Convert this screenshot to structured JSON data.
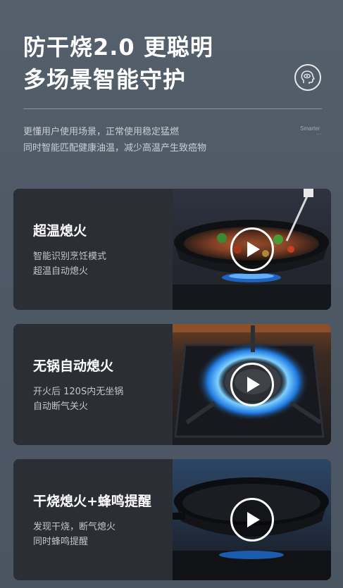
{
  "header": {
    "title_line1": "防干烧2.0 更聪明",
    "title_line2": "多场景智能守护",
    "badge_icon": "head-eye-icon"
  },
  "intro": {
    "line1": "更懂用户使用场景，正常使用稳定猛燃",
    "line2": "同时智能匹配健康油温，减少高温产生致癌物",
    "tag": "Smarter",
    "tag_dots": "···"
  },
  "cards": [
    {
      "title": "超温熄火",
      "line1": "智能识别烹饪模式",
      "line2": "超温自动熄火",
      "media": "wok-with-vegetables-and-thermometer",
      "play_icon": "play-icon"
    },
    {
      "title": "无锅自动熄火",
      "line1": "开火后 120S内无坐锅",
      "line2": "自动断气关火",
      "media": "lit-gas-burner",
      "play_icon": "play-icon"
    },
    {
      "title": "干烧熄火+蜂鸣提醒",
      "line1": "发现干烧，断气熄火",
      "line2": "同时蜂鸣提醒",
      "media": "empty-pan-on-burner",
      "play_icon": "play-icon"
    }
  ],
  "colors": {
    "background": "#4e5966",
    "card": "#2b2e34",
    "flame": "#2a8cff"
  }
}
